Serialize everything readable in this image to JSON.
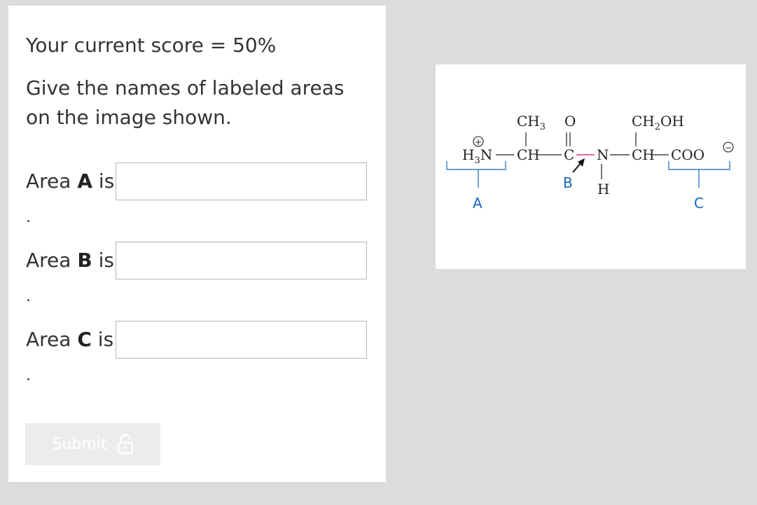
{
  "score_text": "Your current score = 50%",
  "question": "Give the names of labeled areas on the image shown.",
  "fields": [
    {
      "prefix": "Area ",
      "letter": "A",
      "suffix": " is",
      "value": "",
      "trailing": "."
    },
    {
      "prefix": "Area ",
      "letter": "B",
      "suffix": " is",
      "value": "",
      "trailing": "."
    },
    {
      "prefix": "Area ",
      "letter": "C",
      "suffix": " is",
      "value": "",
      "trailing": "."
    }
  ],
  "submit": {
    "label": "Submit",
    "icon": "lock-icon"
  },
  "figure": {
    "ch3": "CH",
    "ch3_sub": "3",
    "o": "O",
    "ch2oh_a": "CH",
    "ch2oh_sub": "2",
    "ch2oh_b": "OH",
    "h3n_h": "H",
    "h3n_sub": "3",
    "h3n_n": "N",
    "ch1": "CH",
    "c": "C",
    "n": "N",
    "ch2": "CH",
    "coo": "COO",
    "h": "H",
    "plus": "+",
    "minus": "−",
    "label_a": "A",
    "label_b": "B",
    "label_c": "C",
    "colors": {
      "label": "#1565c0",
      "peptide_bond": "#d6338a"
    }
  }
}
